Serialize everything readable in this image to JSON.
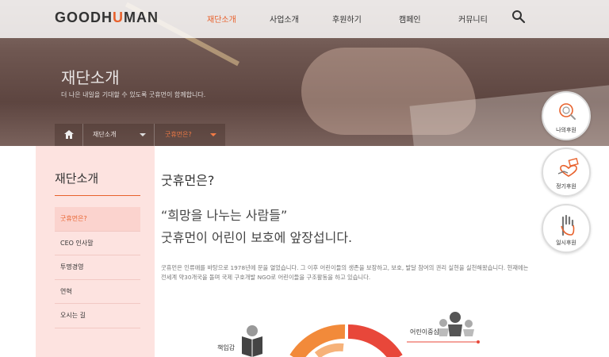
{
  "header": {
    "logo_prefix": "GOODH",
    "logo_accent": "U",
    "logo_suffix": "MAN",
    "nav": [
      {
        "label": "재단소개",
        "active": true
      },
      {
        "label": "사업소개",
        "active": false
      },
      {
        "label": "후원하기",
        "active": false
      },
      {
        "label": "캠페인",
        "active": false
      },
      {
        "label": "커뮤니티",
        "active": false
      }
    ],
    "search_icon": "search-icon"
  },
  "hero": {
    "title": "재단소개",
    "subtitle": "더 나은 내일을 기대할 수 있도록 굿휴먼이 함께합니다."
  },
  "breadcrumb": {
    "home_icon": "home-icon",
    "section": "재단소개",
    "current": "굿휴먼은?"
  },
  "floating": {
    "my_donation": "나의후원",
    "regular_donation": "정기후원",
    "temporary_donation": "일시후원"
  },
  "sidemenu": {
    "title": "재단소개",
    "items": [
      {
        "label": "굿휴먼은?",
        "active": true
      },
      {
        "label": "CEO 인사말",
        "active": false
      },
      {
        "label": "투명경영",
        "active": false
      },
      {
        "label": "연혁",
        "active": false
      },
      {
        "label": "오시는 길",
        "active": false
      }
    ]
  },
  "content": {
    "title": "굿휴먼은?",
    "quote_line1": "“희망을 나누는 사람들”",
    "quote_line2": "굿휴먼이 어린이 보호에 앞장섭니다.",
    "description": "굿휴먼은 인류애를 바탕으로 1978년에 문을 열었습니다. 그 이후 어린이들의 생존을 보장하고, 보호, 발달 참여의 권리 실현을 실천해왔습니다. 현재에는 전세계 약30개국을 돌며 국제 구호개발 NGO로 어린이들을 구조활동을 하고 있습니다."
  },
  "infographic": {
    "label_left": "책임감",
    "label_right": "어린이중심"
  },
  "colors": {
    "accent": "#e8612c",
    "sidemenu_bg": "#fde3e0"
  }
}
